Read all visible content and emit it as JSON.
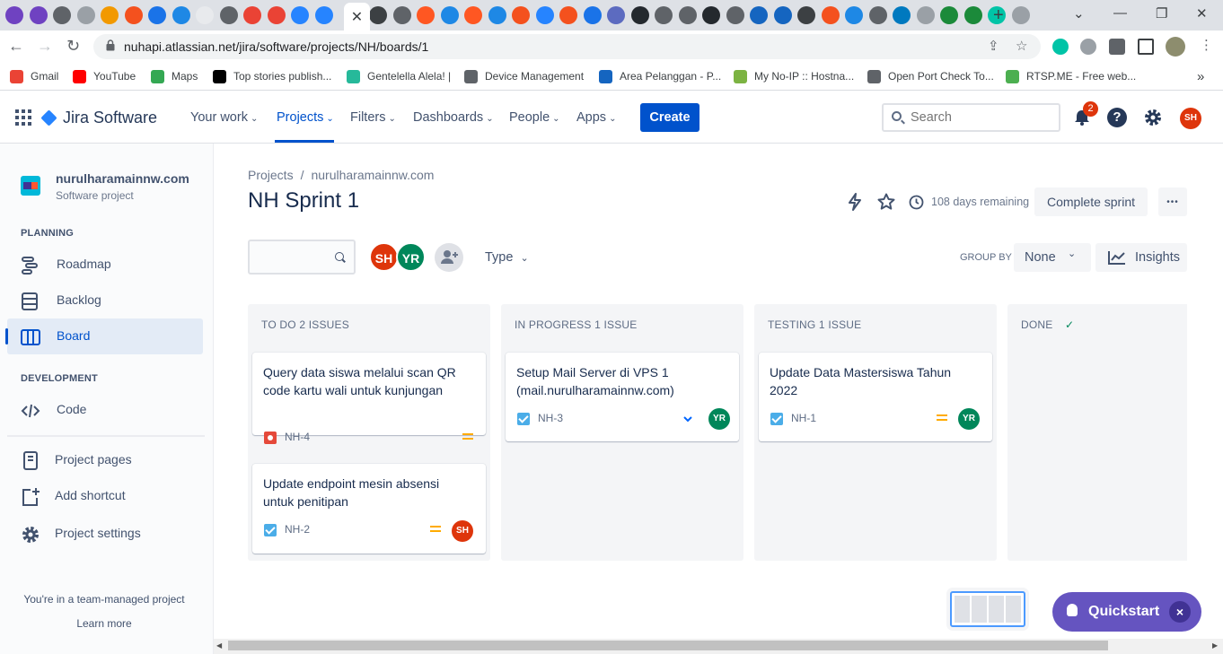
{
  "browser": {
    "tab_icon_colors": [
      "#6f42c1",
      "#6f42c1",
      "#5f6368",
      "#9aa0a6",
      "#f29900",
      "#f4511e",
      "#1a73e8",
      "#1e88e5",
      "#e8eaed",
      "#5f6368",
      "#ea4335",
      "#ea4335",
      "#2684ff",
      "#2684ff",
      "#3c4043",
      "#5f6368",
      "#ff5722",
      "#1e88e5",
      "#ff5722",
      "#1e88e5",
      "#f4511e",
      "#2684ff",
      "#f4511e",
      "#1a73e8",
      "#5c6bc0",
      "#24292e",
      "#5f6368",
      "#5f6368",
      "#24292e",
      "#5f6368",
      "#1565c0",
      "#1565c0",
      "#3c4043",
      "#f4511e",
      "#1e88e5",
      "#5f6368",
      "#0079bf",
      "#9aa0a6",
      "#1b8a3a",
      "#1b8a3a",
      "#00c4a7",
      "#9aa0a6"
    ],
    "active_tab_icon": "close-icon",
    "url": "nuhapi.atlassian.net/jira/software/projects/NH/boards/1",
    "bookmarks": [
      {
        "label": "Gmail",
        "color": "#ea4335"
      },
      {
        "label": "YouTube",
        "color": "#ff0000"
      },
      {
        "label": "Maps",
        "color": "#34a853"
      },
      {
        "label": "Top stories publish...",
        "color": "#000000"
      },
      {
        "label": "Gentelella Alela! |",
        "color": "#26b99a"
      },
      {
        "label": "Device Management",
        "color": "#5f6368"
      },
      {
        "label": "Area Pelanggan - P...",
        "color": "#1565c0"
      },
      {
        "label": "My No-IP :: Hostna...",
        "color": "#7cb342"
      },
      {
        "label": "Open Port Check To...",
        "color": "#5f6368"
      },
      {
        "label": "RTSP.ME - Free web...",
        "color": "#4caf50"
      }
    ],
    "more_bookmarks": "»"
  },
  "header": {
    "product": "Jira Software",
    "nav": [
      {
        "label": "Your work",
        "active": false
      },
      {
        "label": "Projects",
        "active": true
      },
      {
        "label": "Filters",
        "active": false
      },
      {
        "label": "Dashboards",
        "active": false
      },
      {
        "label": "People",
        "active": false
      },
      {
        "label": "Apps",
        "active": false
      }
    ],
    "create_label": "Create",
    "search_placeholder": "Search",
    "notification_count": "2",
    "help_label": "?",
    "user_initials": "SH"
  },
  "sidebar": {
    "project_name": "nurulharamainnw.com",
    "project_type": "Software project",
    "planning_label": "PLANNING",
    "planning_items": [
      "Roadmap",
      "Backlog",
      "Board"
    ],
    "development_label": "DEVELOPMENT",
    "development_items": [
      "Code"
    ],
    "other_items": [
      "Project pages",
      "Add shortcut",
      "Project settings"
    ],
    "footer_text": "You're in a team-managed project",
    "learn_more": "Learn more"
  },
  "main": {
    "breadcrumb": [
      "Projects",
      "nurulharamainnw.com"
    ],
    "breadcrumb_sep": "/",
    "title": "NH Sprint 1",
    "days_remaining": "108 days remaining",
    "complete_sprint": "Complete sprint",
    "more": "•••",
    "filter_avatars": [
      "SH",
      "YR"
    ],
    "type_filter": "Type",
    "group_by_label": "GROUP BY",
    "group_by_value": "None",
    "insights": "Insights"
  },
  "columns": [
    {
      "title": "TO DO 2 ISSUES",
      "cards": [
        {
          "summary": "Query data siswa melalui scan QR code kartu wali untuk kunjungan",
          "key": "NH-4",
          "type": "bug",
          "priority": "medium",
          "assignee": ""
        },
        {
          "summary": "Update endpoint mesin absensi untuk penitipan",
          "key": "NH-2",
          "type": "task",
          "priority": "medium",
          "assignee": "SH"
        }
      ]
    },
    {
      "title": "IN PROGRESS 1 ISSUE",
      "cards": [
        {
          "summary": "Setup Mail Server di VPS 1 (mail.nurulharamainnw.com)",
          "key": "NH-3",
          "type": "task",
          "priority": "low",
          "assignee": "YR"
        }
      ]
    },
    {
      "title": "TESTING 1 ISSUE",
      "cards": [
        {
          "summary": "Update Data Mastersiswa Tahun 2022",
          "key": "NH-1",
          "type": "task",
          "priority": "medium",
          "assignee": "YR"
        }
      ]
    },
    {
      "title": "DONE",
      "cards": []
    }
  ],
  "done_check": "✓",
  "quickstart": {
    "label": "Quickstart",
    "close": "×"
  },
  "colors": {
    "primary": "#0052cc",
    "sh_avatar": "#de350b",
    "yr_avatar": "#00875a",
    "quickstart": "#6554c0"
  }
}
